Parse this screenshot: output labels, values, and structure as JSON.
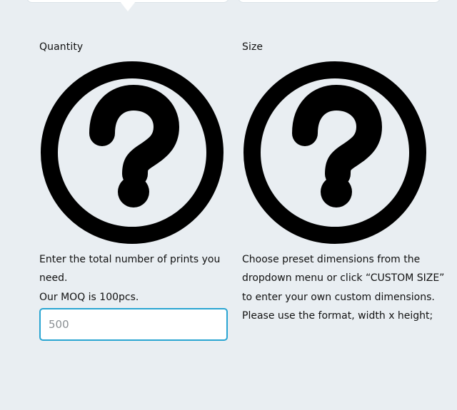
{
  "quantity": {
    "label": "Quantity",
    "icon": "question-circle-icon",
    "help_line1": "Enter the total number of prints you need.",
    "help_line2": "Our MOQ is 100pcs.",
    "input_placeholder": "500"
  },
  "size": {
    "label": "Size",
    "icon": "question-circle-icon",
    "help_line1": "Choose preset dimensions from the dropdown menu or click “CUSTOM SIZE” to enter your own custom dimensions.",
    "help_line2": "Please use the format, width x height;"
  },
  "colors": {
    "background": "#e9eef2",
    "input_border": "#2aa5d2",
    "icon": "#000000"
  }
}
